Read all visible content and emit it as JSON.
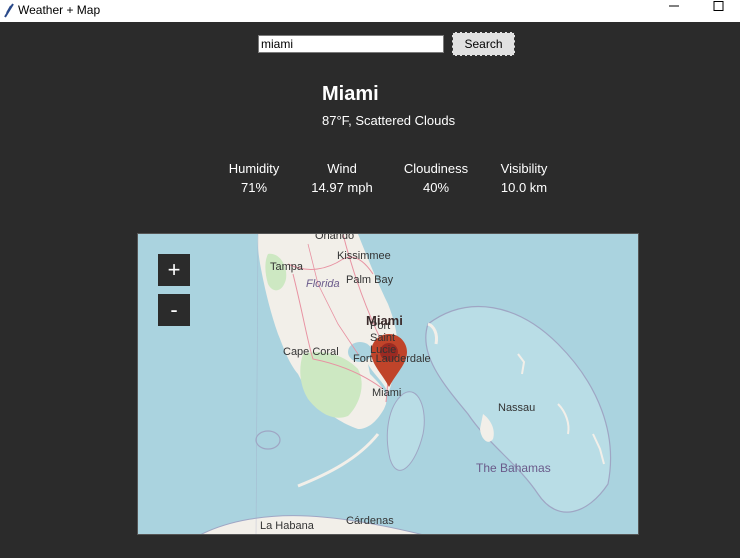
{
  "window": {
    "title": "Weather + Map"
  },
  "search": {
    "value": "miami",
    "button_label": "Search"
  },
  "weather": {
    "city": "Miami",
    "summary": "87°F, Scattered Clouds",
    "stats": [
      {
        "label": "Humidity",
        "value": "71%"
      },
      {
        "label": "Wind",
        "value": "14.97 mph"
      },
      {
        "label": "Cloudiness",
        "value": "40%"
      },
      {
        "label": "Visibility",
        "value": "10.0 km"
      }
    ]
  },
  "map": {
    "zoom_in_label": "+",
    "zoom_out_label": "-",
    "marker_label": "Miami",
    "marker_color": "#c0442a",
    "labels": {
      "orlando": "Orlando",
      "tampa": "Tampa",
      "kissimmee": "Kissimmee",
      "florida": "Florida",
      "palm_bay": "Palm Bay",
      "port_saint_lucie": "Port Saint Lucie",
      "cape_coral": "Cape Coral",
      "fort_lauderdale": "Fort Lauderdale",
      "miami": "Miami",
      "nassau": "Nassau",
      "the_bahamas": "The Bahamas",
      "la_habana": "La Habana",
      "cardenas": "Cárdenas"
    }
  }
}
